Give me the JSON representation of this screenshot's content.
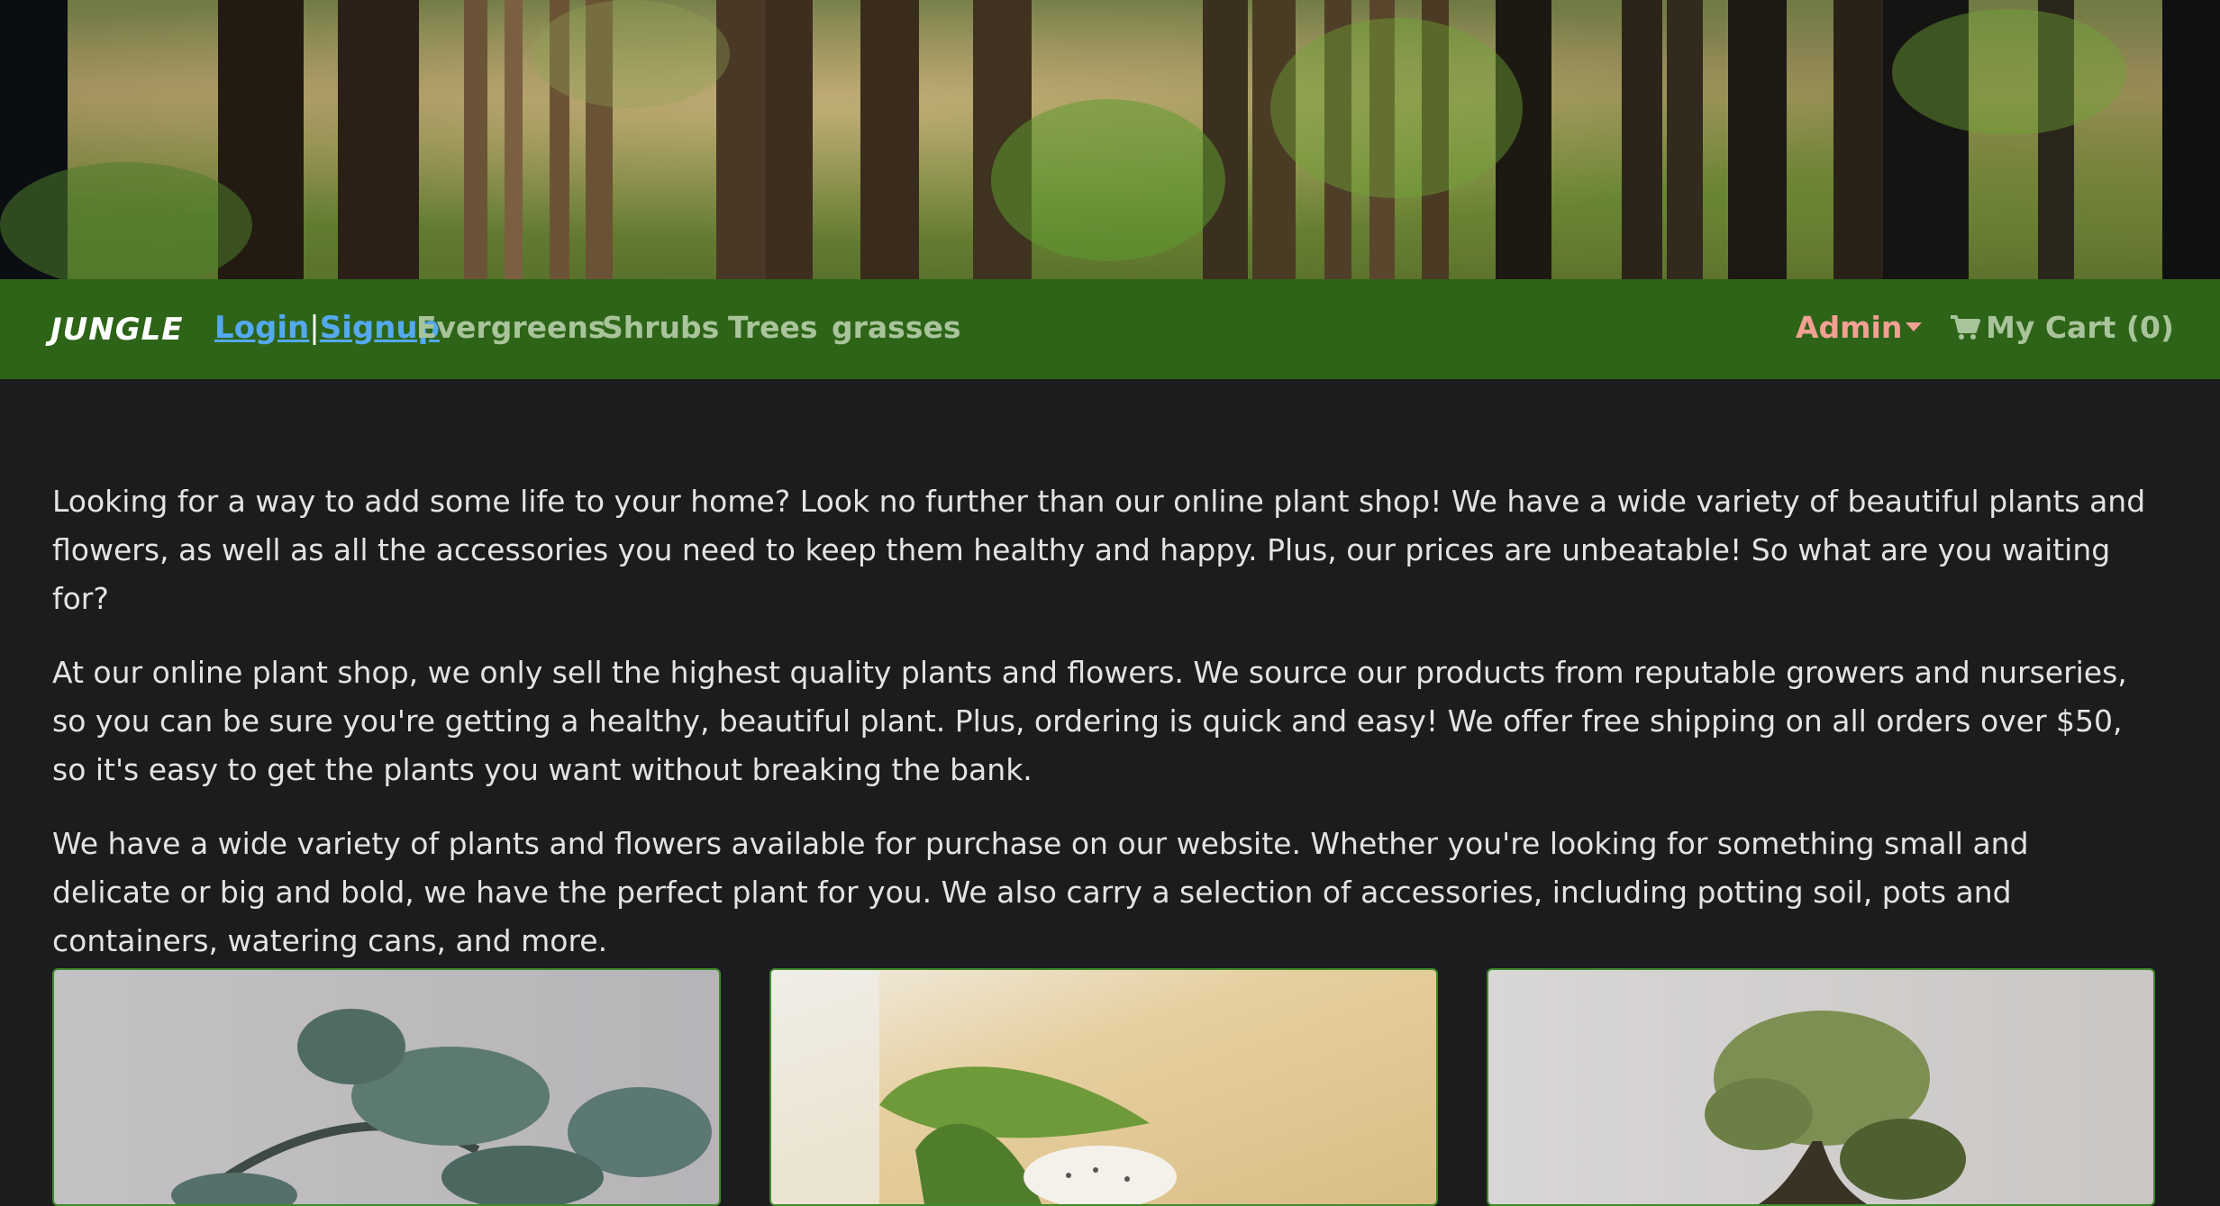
{
  "brand": "JUNGLE",
  "auth": {
    "login": "Login",
    "separator": "|",
    "signup": "Signup"
  },
  "nav": {
    "categories": [
      "Evergreens",
      "Shrubs",
      "Trees",
      "grasses"
    ],
    "admin_label": "Admin",
    "cart_label": "My Cart (0)"
  },
  "intro": {
    "paragraphs": [
      "Looking for a way to add some life to your home? Look no further than our online plant shop! We have a wide variety of beautiful plants and flowers, as well as all the accessories you need to keep them healthy and happy. Plus, our prices are unbeatable! So what are you waiting for?",
      "At our online plant shop, we only sell the highest quality plants and flowers. We source our products from reputable growers and nurseries, so you can be sure you're getting a healthy, beautiful plant. Plus, ordering is quick and easy! We offer free shipping on all orders over $50, so it's easy to get the plants you want without breaking the bank.",
      "We have a wide variety of plants and flowers available for purchase on our website. Whether you're looking for something small and delicate or big and bold, we have the perfect plant for you. We also carry a selection of accessories, including potting soil, pots and containers, watering cans, and more."
    ]
  },
  "colors": {
    "navbar": "#2d6418",
    "page_bg": "#1b1c1d",
    "link": "#55a9f0",
    "admin": "#f2a093",
    "nav_text": "#a9c49a",
    "card_border": "#3e8a2c"
  },
  "icons": {
    "cart": "shopping-cart-icon",
    "admin_caret": "caret-down-icon"
  }
}
